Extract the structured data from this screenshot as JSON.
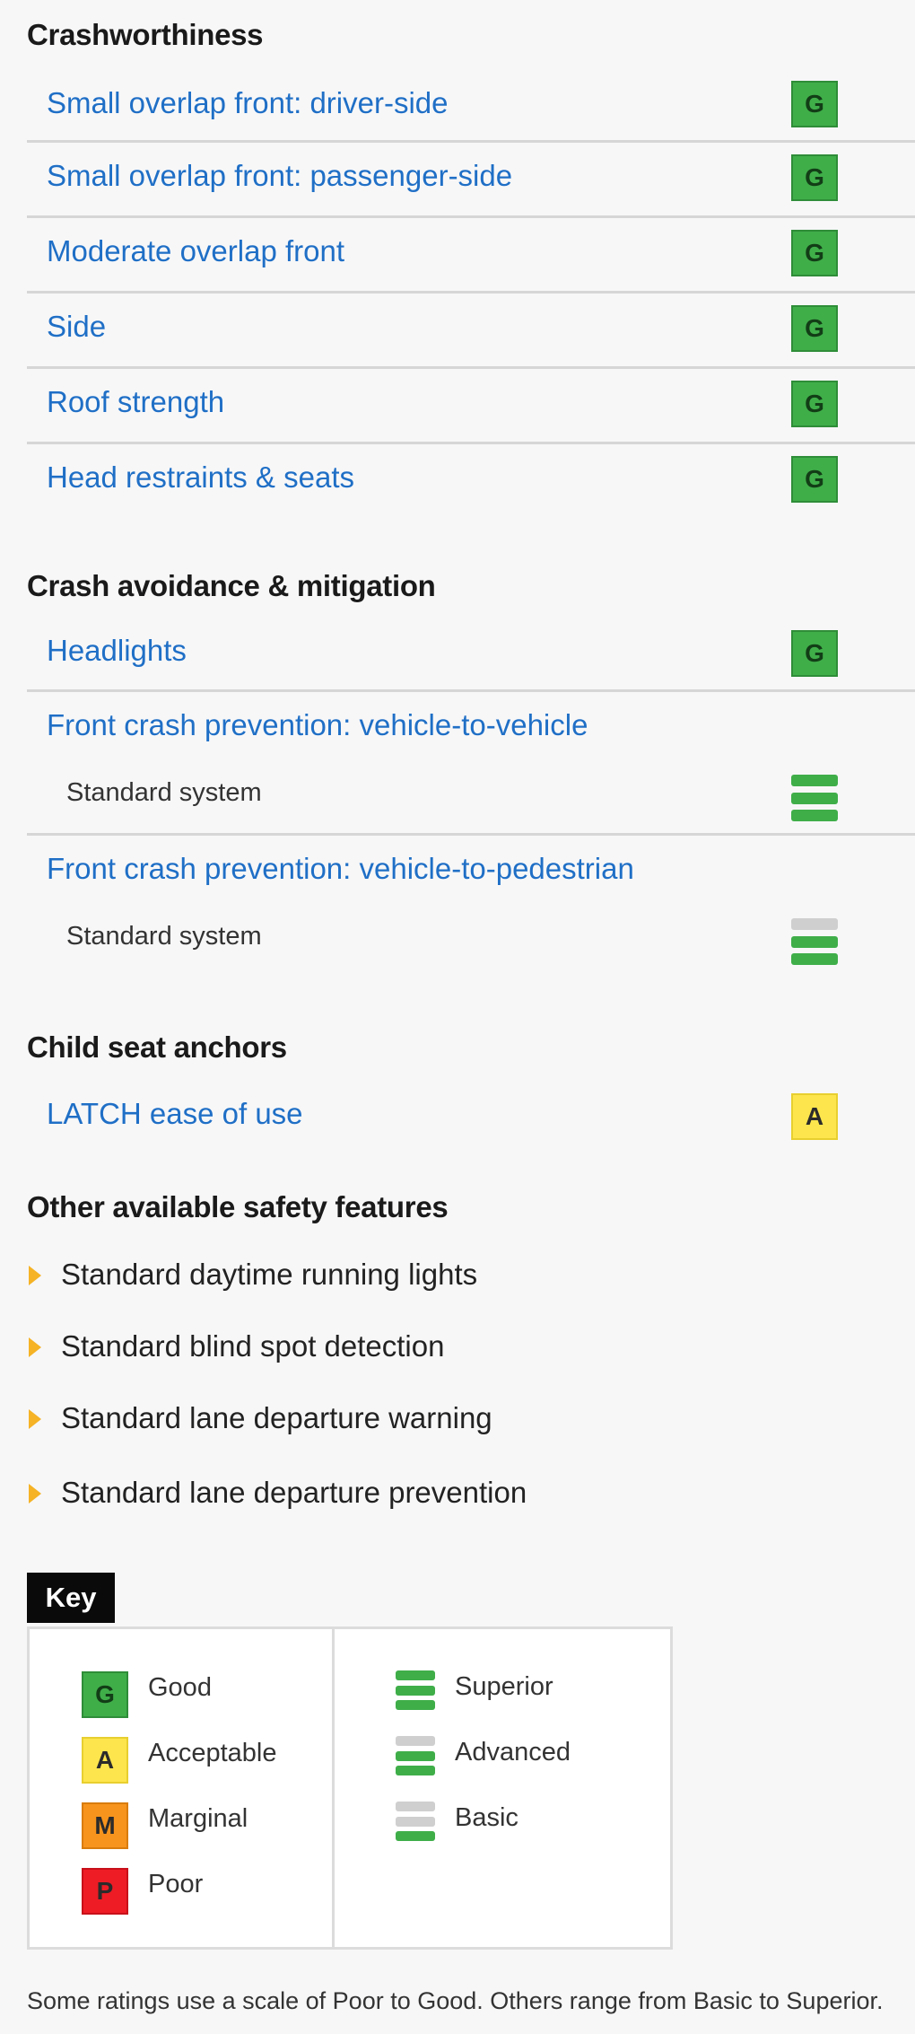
{
  "crashworthiness": {
    "title": "Crashworthiness",
    "items": [
      {
        "label": "Small overlap front: driver-side",
        "rating": "G"
      },
      {
        "label": "Small overlap front: passenger-side",
        "rating": "G"
      },
      {
        "label": "Moderate overlap front",
        "rating": "G"
      },
      {
        "label": "Side",
        "rating": "G"
      },
      {
        "label": "Roof strength",
        "rating": "G"
      },
      {
        "label": "Head restraints & seats",
        "rating": "G"
      }
    ]
  },
  "avoidance": {
    "title": "Crash avoidance & mitigation",
    "headlights": {
      "label": "Headlights",
      "rating": "G"
    },
    "front_v2v": {
      "label": "Front crash prevention: vehicle-to-vehicle",
      "sub": "Standard system",
      "level": "Superior"
    },
    "front_v2p": {
      "label": "Front crash prevention: vehicle-to-pedestrian",
      "sub": "Standard system",
      "level": "Advanced"
    }
  },
  "child_seat": {
    "title": "Child seat anchors",
    "latch": {
      "label": "LATCH ease of use",
      "rating": "A"
    }
  },
  "other": {
    "title": "Other available safety features",
    "features": [
      "Standard daytime running lights",
      "Standard blind spot detection",
      "Standard lane departure warning",
      "Standard lane departure prevention"
    ]
  },
  "key": {
    "title": "Key",
    "ratings": [
      {
        "letter": "G",
        "label": "Good"
      },
      {
        "letter": "A",
        "label": "Acceptable"
      },
      {
        "letter": "M",
        "label": "Marginal"
      },
      {
        "letter": "P",
        "label": "Poor"
      }
    ],
    "levels": [
      {
        "label": "Superior"
      },
      {
        "label": "Advanced"
      },
      {
        "label": "Basic"
      }
    ]
  },
  "footnote": "Some ratings use a scale of Poor to Good. Others range from Basic to Superior.",
  "colors": {
    "good": "#3fae49",
    "acceptable": "#fde54d",
    "marginal": "#f7941d",
    "poor": "#ee1c25",
    "link": "#1f6fc6",
    "feature_arrow": "#f5b325"
  }
}
